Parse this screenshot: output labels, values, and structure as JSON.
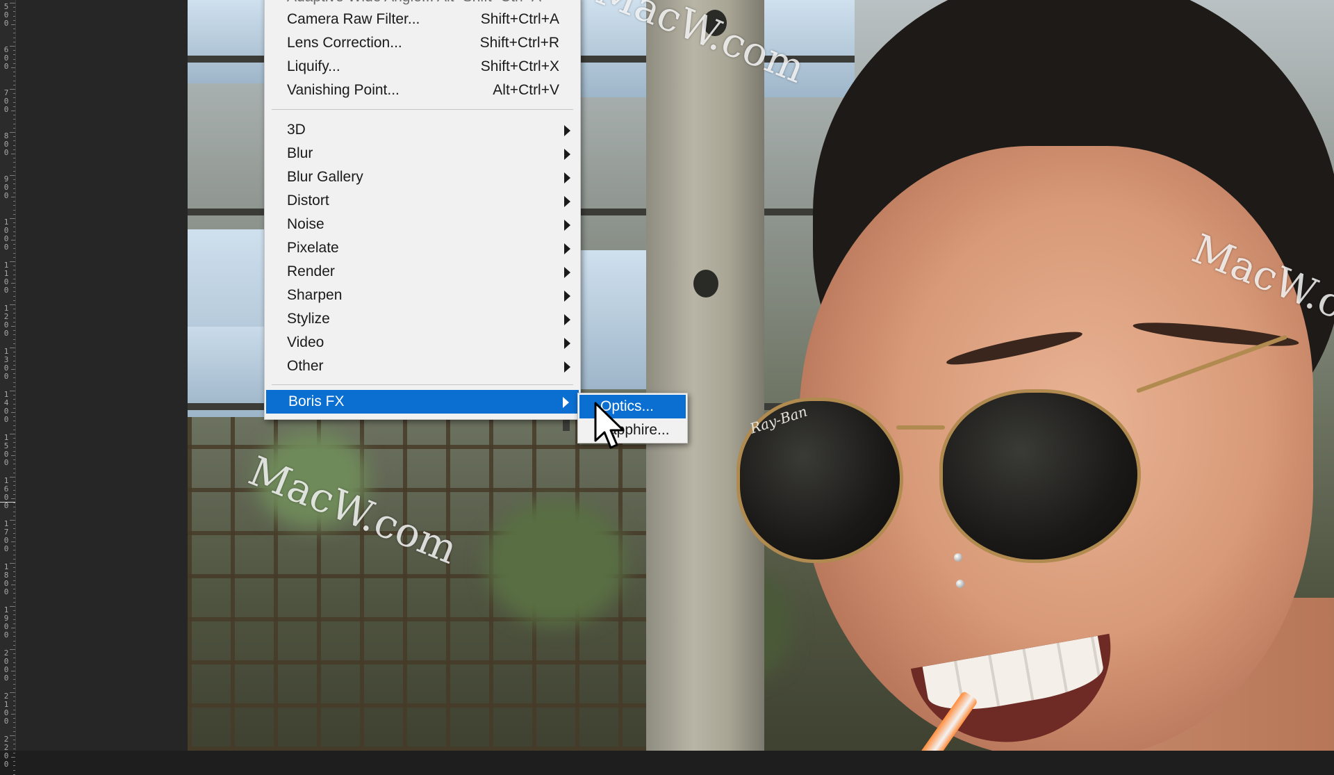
{
  "ruler": {
    "labels": [
      "5\n0\n0",
      "6\n0\n0",
      "7\n0\n0",
      "8\n0\n0",
      "9\n0\n0",
      "1\n0\n0\n0",
      "1\n1\n0\n0",
      "1\n2\n0\n0",
      "1\n3\n0\n0",
      "1\n4\n0\n0",
      "1\n5\n0\n0",
      "1\n6\n0\n0",
      "1\n7\n0\n0",
      "1\n8\n0\n0",
      "1\n9\n0\n0",
      "2\n0\n0\n0",
      "2\n1\n0\n0",
      "2\n2\n0\n0"
    ]
  },
  "watermark": {
    "text_top": "MacW.com",
    "text_right": "MacW.co",
    "text_left": "MacW.com"
  },
  "photo": {
    "lens_logo": "Ray-Ban"
  },
  "filter_menu": {
    "partial_top_item": "Adaptive Wide Angle...    Alt+Shift+Ctrl+A",
    "items_group1": [
      {
        "label": "Camera Raw Filter...",
        "shortcut": "Shift+Ctrl+A"
      },
      {
        "label": "Lens Correction...",
        "shortcut": "Shift+Ctrl+R"
      },
      {
        "label": "Liquify...",
        "shortcut": "Shift+Ctrl+X"
      },
      {
        "label": "Vanishing Point...",
        "shortcut": "Alt+Ctrl+V"
      }
    ],
    "items_group2": [
      {
        "label": "3D"
      },
      {
        "label": "Blur"
      },
      {
        "label": "Blur Gallery"
      },
      {
        "label": "Distort"
      },
      {
        "label": "Noise"
      },
      {
        "label": "Pixelate"
      },
      {
        "label": "Render"
      },
      {
        "label": "Sharpen"
      },
      {
        "label": "Stylize"
      },
      {
        "label": "Video"
      },
      {
        "label": "Other"
      }
    ],
    "selected_item": {
      "label": "Boris FX"
    }
  },
  "submenu": {
    "items": [
      {
        "label": "Optics..."
      },
      {
        "label": "Sapphire..."
      }
    ]
  },
  "colors": {
    "menu_bg": "#f1f1f1",
    "selection": "#0a6fd1",
    "ruler_bg": "#2b2b2b"
  }
}
